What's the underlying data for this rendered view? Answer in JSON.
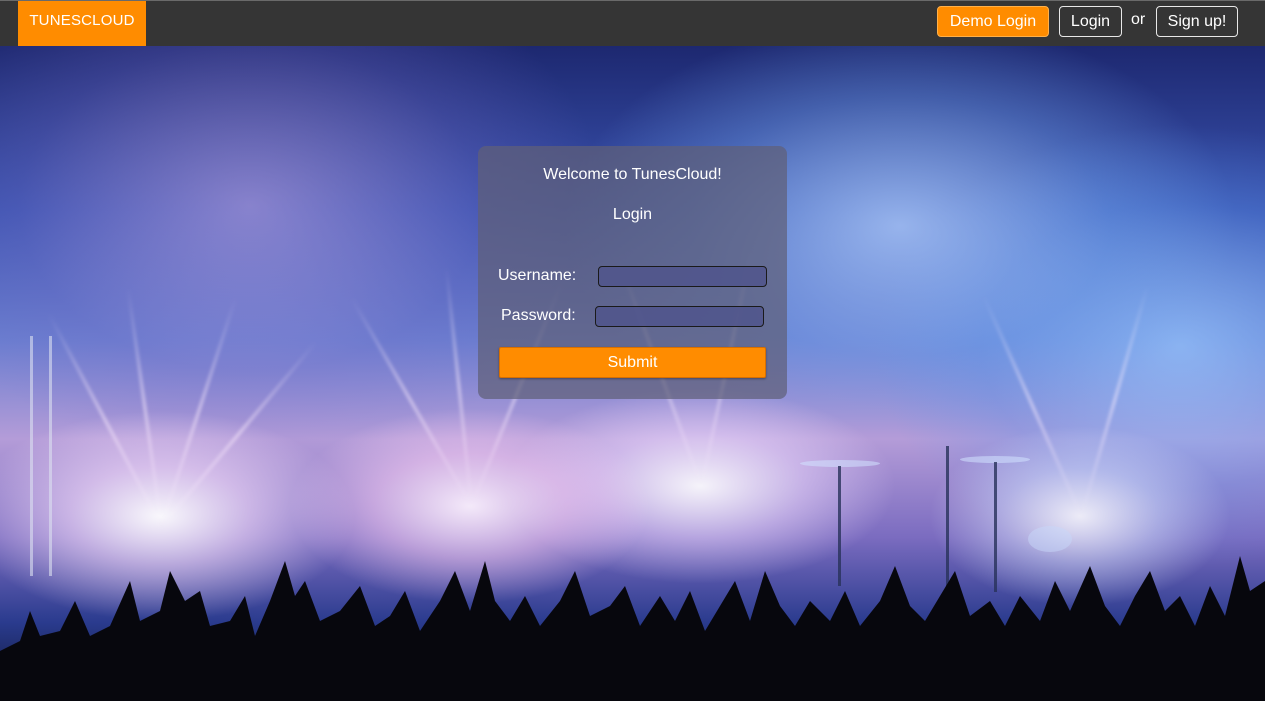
{
  "app": {
    "brand": "TUNESCLOUD",
    "accent_color": "#ff8c00",
    "nav_color": "#353535"
  },
  "nav": {
    "demo_login_label": "Demo Login",
    "login_label": "Login",
    "or_text": "or",
    "signup_label": "Sign up!"
  },
  "login_form": {
    "title": "Welcome to TunesCloud!",
    "subtitle": "Login",
    "username_label": "Username:",
    "username_value": "",
    "password_label": "Password:",
    "password_value": "",
    "submit_label": "Submit"
  },
  "background": {
    "icon": "concert-crowd-stage-lights"
  }
}
